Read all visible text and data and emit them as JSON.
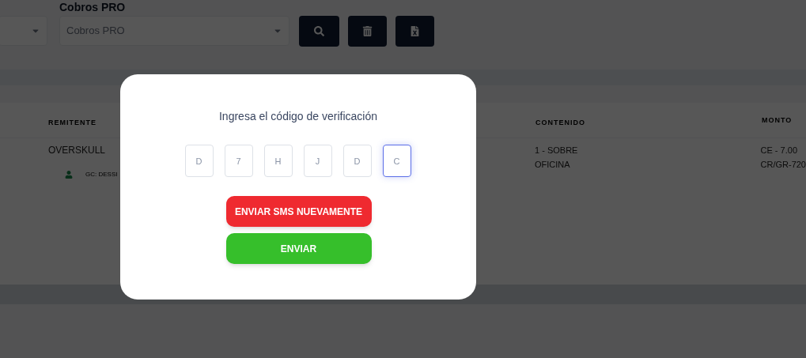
{
  "filters": {
    "label": "Cobros PRO",
    "select_2": {
      "value": "Cobros PRO"
    }
  },
  "toolbar": [
    {
      "kind": "search"
    },
    {
      "kind": "delete"
    },
    {
      "kind": "excel"
    }
  ],
  "table": {
    "columns": [
      "REMITENTE",
      "CONTENIDO",
      "MONTO"
    ],
    "rows": [
      {
        "remitente": "OVERSKULL",
        "remitente_sub": "GC: DESSI",
        "contenido": [
          "1 - SOBRE",
          "OFICINA"
        ],
        "monto": [
          "CE - 7.00",
          "CR/GR-720"
        ]
      }
    ]
  },
  "modal": {
    "title": "Ingresa el código de verificación",
    "code": [
      {
        "value": "D",
        "focused": false
      },
      {
        "value": "7",
        "focused": false
      },
      {
        "value": "H",
        "focused": false
      },
      {
        "value": "J",
        "focused": false
      },
      {
        "value": "D",
        "focused": false
      },
      {
        "value": "C",
        "focused": true
      }
    ],
    "buttons": [
      {
        "label": "ENVIAR SMS NUEVAMENTE",
        "kind": "danger"
      },
      {
        "label": "ENVIAR",
        "kind": "success"
      }
    ]
  }
}
